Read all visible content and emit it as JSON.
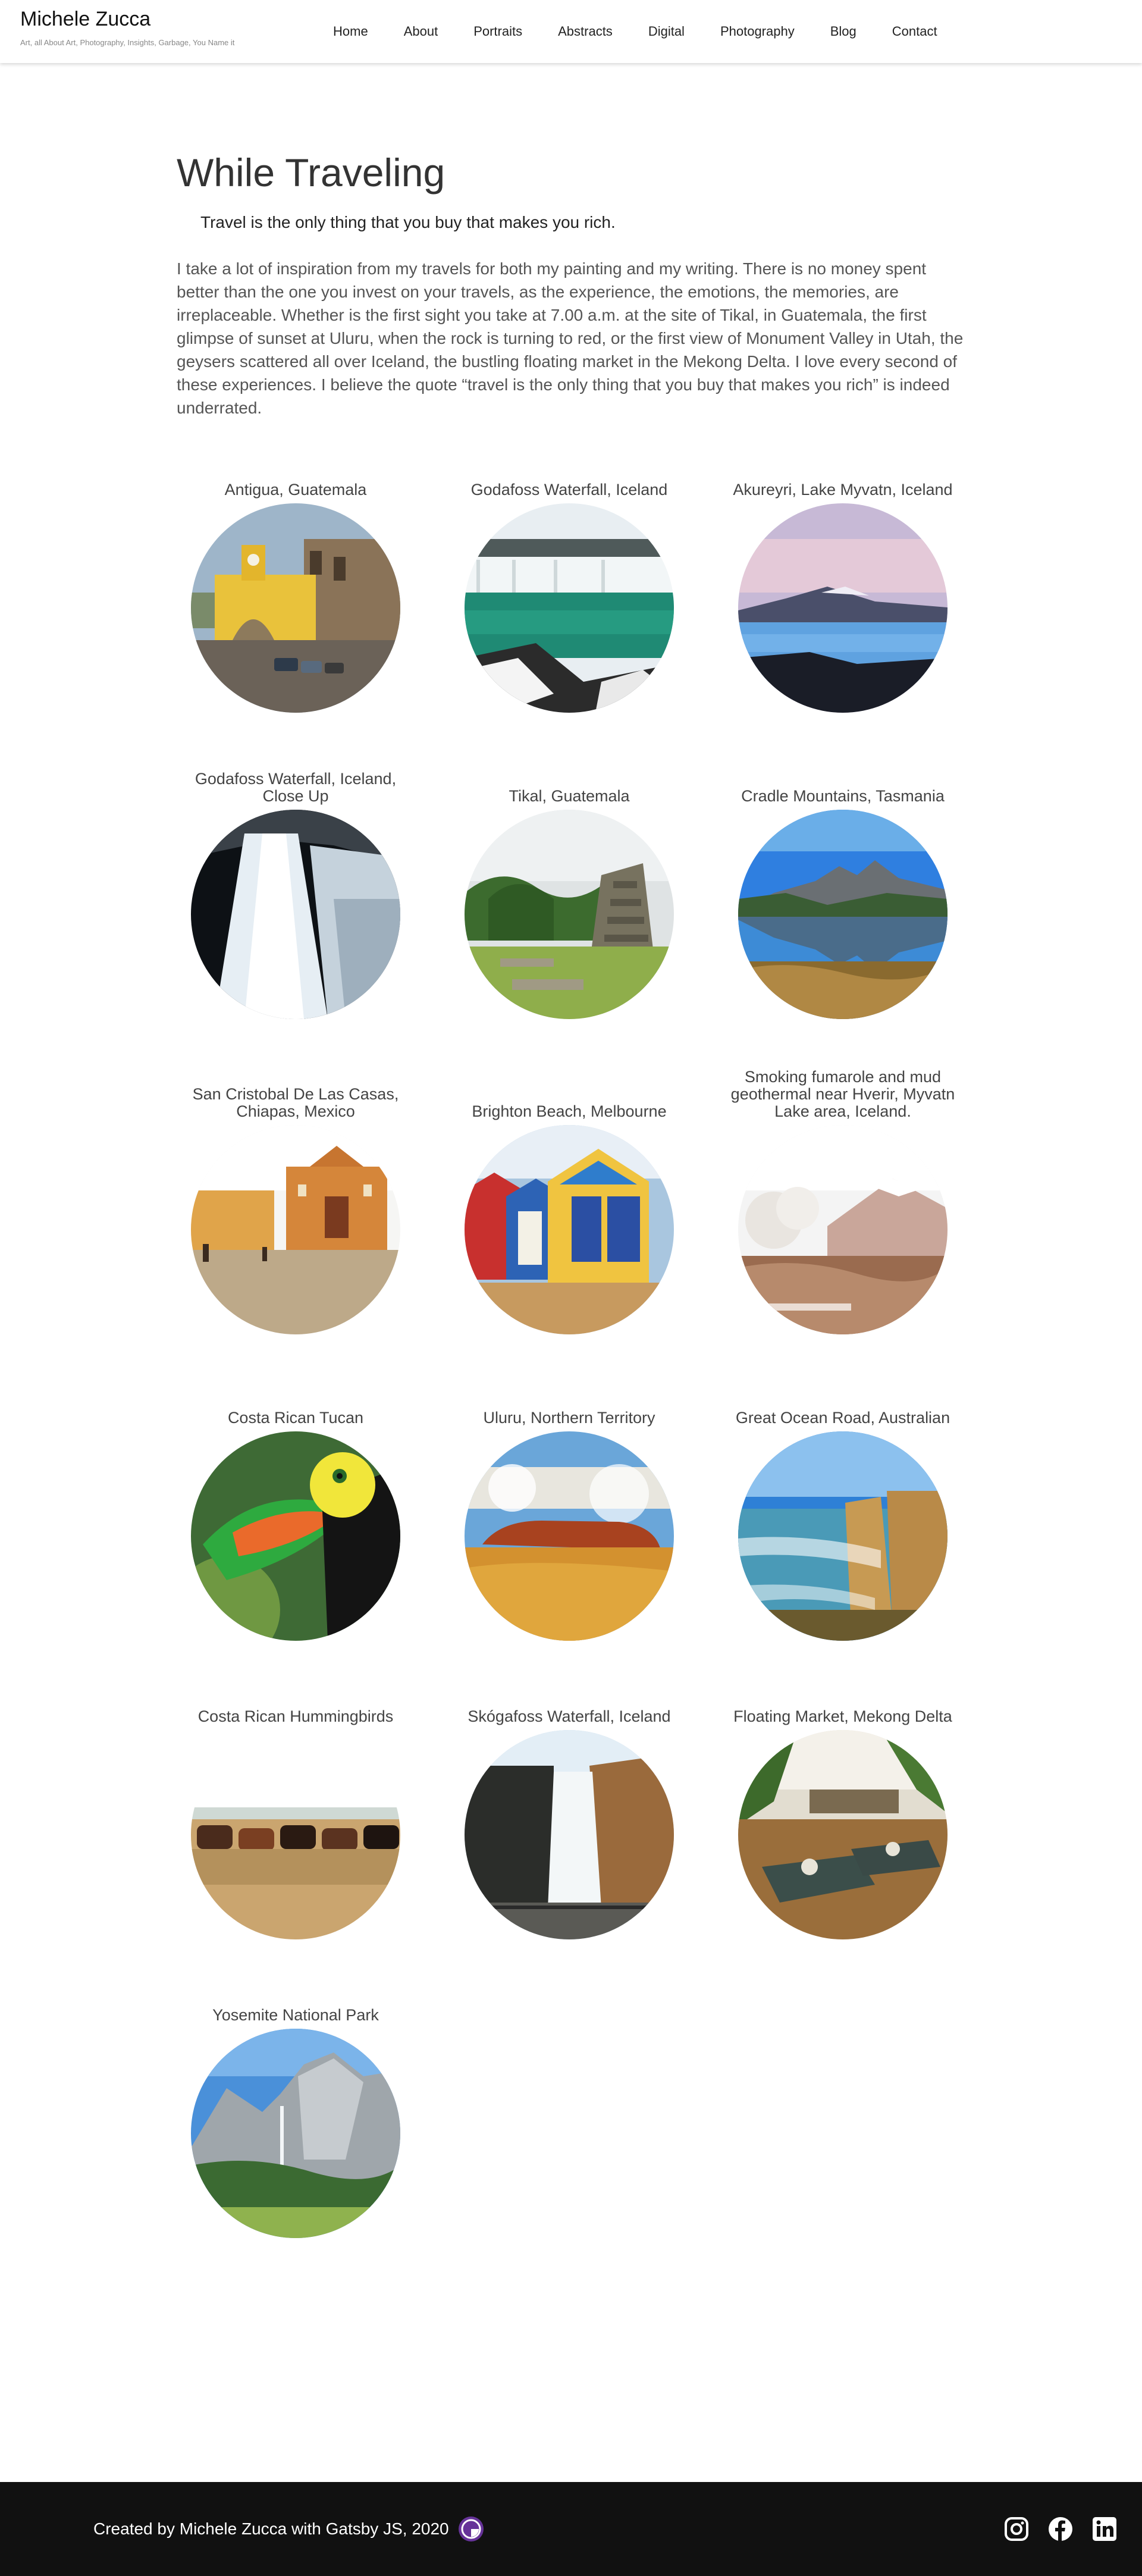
{
  "header": {
    "brand_name": "Michele Zucca",
    "brand_tagline": "Art, all About Art, Photography, Insights, Garbage, You Name it",
    "nav": [
      "Home",
      "About",
      "Portraits",
      "Abstracts",
      "Digital",
      "Photography",
      "Blog",
      "Contact"
    ]
  },
  "main": {
    "title": "While Traveling",
    "quote": "Travel is the only thing that you buy that makes you rich.",
    "intro": "I take a lot of inspiration from my travels for both my painting and my writing. There is no money spent better than the one you invest on your travels, as the experience, the emotions, the memories, are irreplaceable. Whether is the first sight you take at 7.00 a.m. at the site of Tikal, in Guatemala, the first glimpse of sunset at Uluru, when the rock is turning to red, or the first view of Monument Valley in Utah, the geysers scattered all over Iceland, the bustling floating market in the Mekong Delta. I love every second of these experiences. I believe the quote “travel is the only thing that you buy that makes you rich” is indeed underrated."
  },
  "gallery": [
    {
      "caption": "Antigua, Guatemala",
      "scene": "arch"
    },
    {
      "caption": "Godafoss Waterfall, Iceland",
      "scene": "godafoss"
    },
    {
      "caption": "Akureyri, Lake Myvatn, Iceland",
      "scene": "lake"
    },
    {
      "caption": "Godafoss Waterfall, Iceland, Close Up",
      "scene": "falls-close"
    },
    {
      "caption": "Tikal, Guatemala",
      "scene": "tikal"
    },
    {
      "caption": "Cradle Mountains, Tasmania",
      "scene": "cradle"
    },
    {
      "caption": "San Cristobal De Las Casas, Chiapas, Mexico",
      "scene": "church"
    },
    {
      "caption": "Brighton Beach, Melbourne",
      "scene": "huts"
    },
    {
      "caption": "Smoking fumarole and mud geothermal near Hverir, Myvatn Lake area, Iceland.",
      "scene": "fumarole"
    },
    {
      "caption": "Costa Rican Tucan",
      "scene": "toucan"
    },
    {
      "caption": "Uluru, Northern Territory",
      "scene": "uluru"
    },
    {
      "caption": "Great Ocean Road, Australian",
      "scene": "ocean"
    },
    {
      "caption": "Costa Rican Hummingbirds",
      "scene": "horses"
    },
    {
      "caption": "Skógafoss Waterfall, Iceland",
      "scene": "skogafoss"
    },
    {
      "caption": "Floating Market, Mekong Delta",
      "scene": "market"
    },
    {
      "caption": "Yosemite National Park",
      "scene": "yosemite"
    }
  ],
  "footer": {
    "credit": "Created by Michele Zucca with Gatsby JS, 2020",
    "icons": [
      "gatsby-icon",
      "instagram-icon",
      "facebook-icon",
      "linkedin-icon"
    ]
  }
}
